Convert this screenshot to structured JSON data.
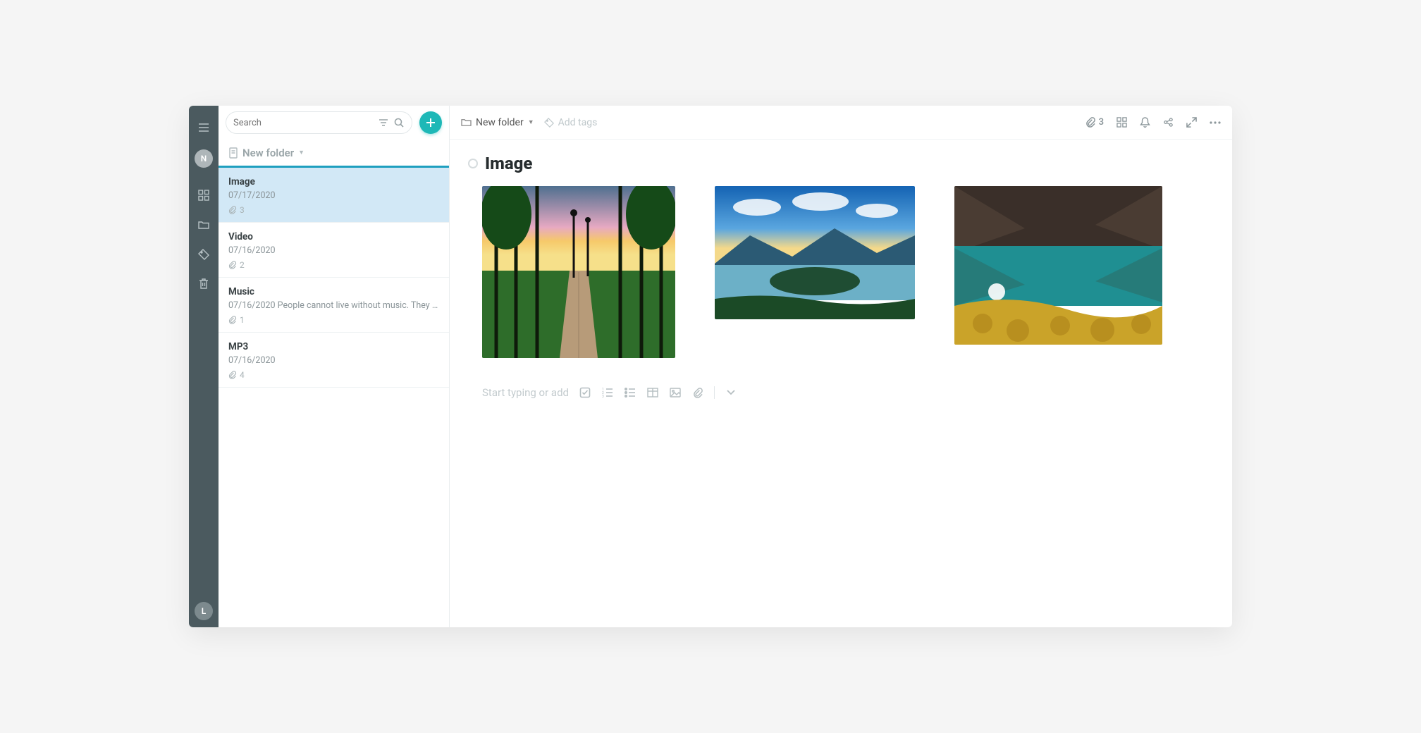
{
  "rail": {
    "top_avatar": "N",
    "bottom_avatar": "L"
  },
  "search": {
    "placeholder": "Search"
  },
  "list": {
    "folder_label": "New folder",
    "notes": [
      {
        "title": "Image",
        "date": "07/17/2020",
        "snippet": "",
        "attachments": "3"
      },
      {
        "title": "Video",
        "date": "07/16/2020",
        "snippet": "",
        "attachments": "2"
      },
      {
        "title": "Music",
        "date": "07/16/2020",
        "snippet": "People cannot live without music. They l...",
        "attachments": "1"
      },
      {
        "title": "MP3",
        "date": "07/16/2020",
        "snippet": "",
        "attachments": "4"
      }
    ]
  },
  "main": {
    "breadcrumb": "New folder",
    "add_tags": "Add tags",
    "attachment_count": "3",
    "title": "Image",
    "placeholder": "Start typing or add"
  }
}
